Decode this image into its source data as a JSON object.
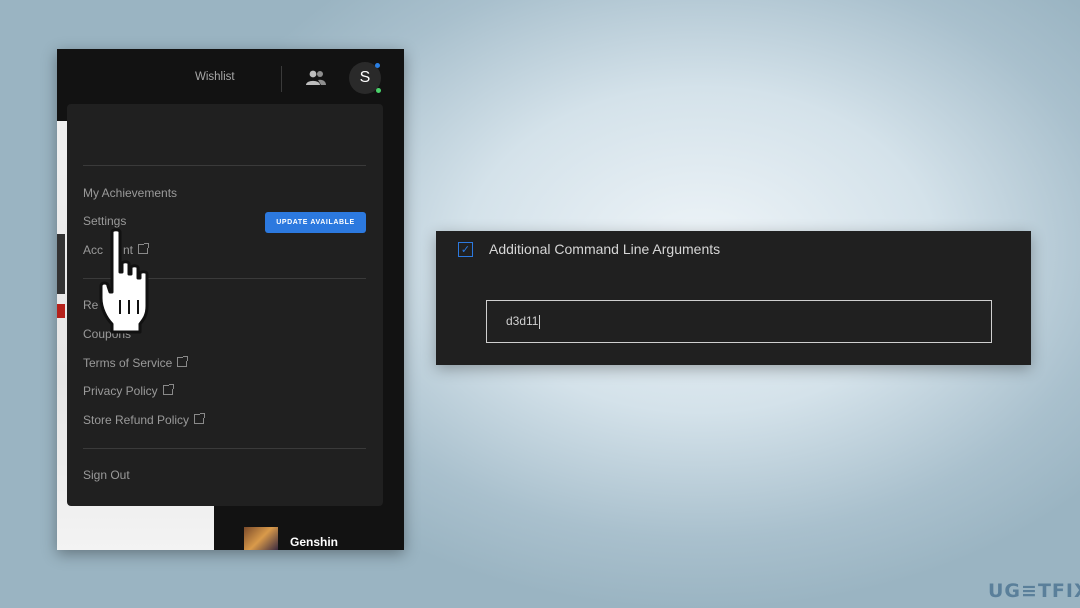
{
  "launcher": {
    "header": {
      "wishlist_label": "Wishlist",
      "avatar_letter": "S",
      "friends_icon": "friends-icon"
    },
    "menu": {
      "items": [
        {
          "label": "My Achievements"
        },
        {
          "label": "Settings",
          "badge": "UPDATE AVAILABLE"
        },
        {
          "label": "Account",
          "visible_text": "Acc      nt",
          "external": true
        },
        {
          "label": "Redeem Code",
          "visible_text": "Re"
        },
        {
          "label": "Coupons",
          "visible_text": "Coupons"
        },
        {
          "label": "Terms of Service",
          "external": true
        },
        {
          "label": "Privacy Policy",
          "external": true
        },
        {
          "label": "Store Refund Policy",
          "external": true
        },
        {
          "label": "Sign Out"
        }
      ]
    },
    "library_item": {
      "label": "Genshin"
    }
  },
  "launch_options": {
    "checkbox_checked": true,
    "label": "Additional Command Line Arguments",
    "input_value": "d3d11"
  },
  "watermark": "UG≡TFIX",
  "colors": {
    "accent_blue": "#2c79df",
    "status_green": "#4bd36b",
    "panel_dark": "#202020"
  }
}
